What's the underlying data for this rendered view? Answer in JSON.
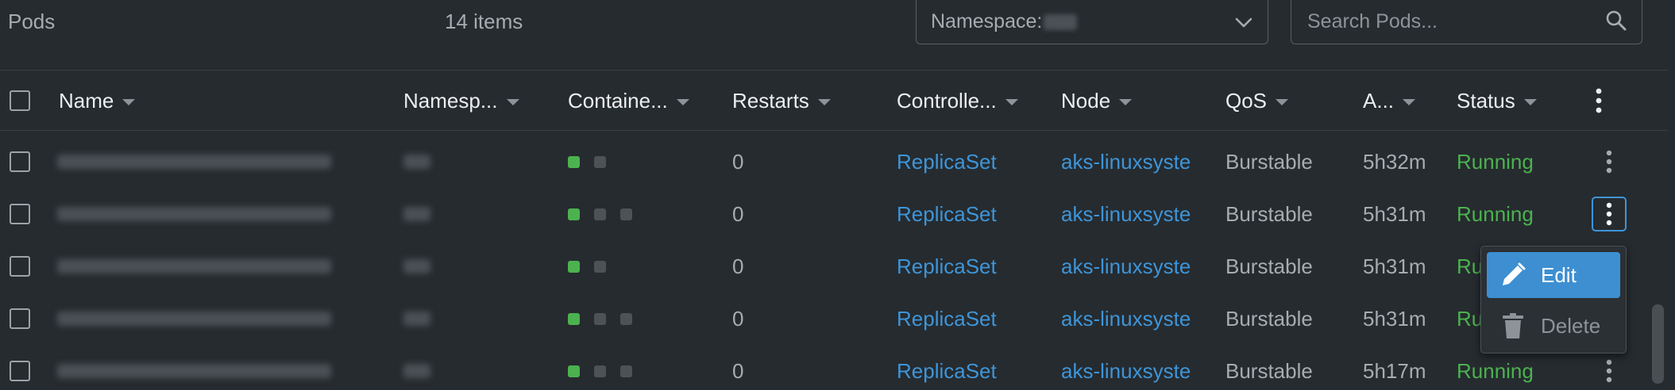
{
  "header": {
    "title": "Pods",
    "count": "14 items",
    "namespace_label": "Namespace:",
    "search_placeholder": "Search Pods..."
  },
  "columns": [
    {
      "label": "Name"
    },
    {
      "label": "Namesp..."
    },
    {
      "label": "Containe..."
    },
    {
      "label": "Restarts"
    },
    {
      "label": "Controlle..."
    },
    {
      "label": "Node"
    },
    {
      "label": "QoS"
    },
    {
      "label": "A..."
    },
    {
      "label": "Status"
    }
  ],
  "rows": [
    {
      "containers": [
        "running",
        "waiting"
      ],
      "restarts": "0",
      "controller": "ReplicaSet",
      "node": "aks-linuxsyste",
      "qos": "Burstable",
      "age": "5h32m",
      "status": "Running"
    },
    {
      "containers": [
        "running",
        "waiting",
        "waiting"
      ],
      "restarts": "0",
      "controller": "ReplicaSet",
      "node": "aks-linuxsyste",
      "qos": "Burstable",
      "age": "5h31m",
      "status": "Running"
    },
    {
      "containers": [
        "running",
        "waiting"
      ],
      "restarts": "0",
      "controller": "ReplicaSet",
      "node": "aks-linuxsyste",
      "qos": "Burstable",
      "age": "5h31m",
      "status": "Ru"
    },
    {
      "containers": [
        "running",
        "waiting",
        "waiting"
      ],
      "restarts": "0",
      "controller": "ReplicaSet",
      "node": "aks-linuxsyste",
      "qos": "Burstable",
      "age": "5h31m",
      "status": "Ru"
    },
    {
      "containers": [
        "running",
        "waiting",
        "waiting"
      ],
      "restarts": "0",
      "controller": "ReplicaSet",
      "node": "aks-linuxsyste",
      "qos": "Burstable",
      "age": "5h17m",
      "status": "Running"
    }
  ],
  "context_menu": {
    "edit_label": "Edit",
    "delete_label": "Delete"
  },
  "colors": {
    "background": "#262b2f",
    "link": "#3e95d8",
    "running": "#4cb24f",
    "menu_highlight": "#3d8fd1"
  }
}
